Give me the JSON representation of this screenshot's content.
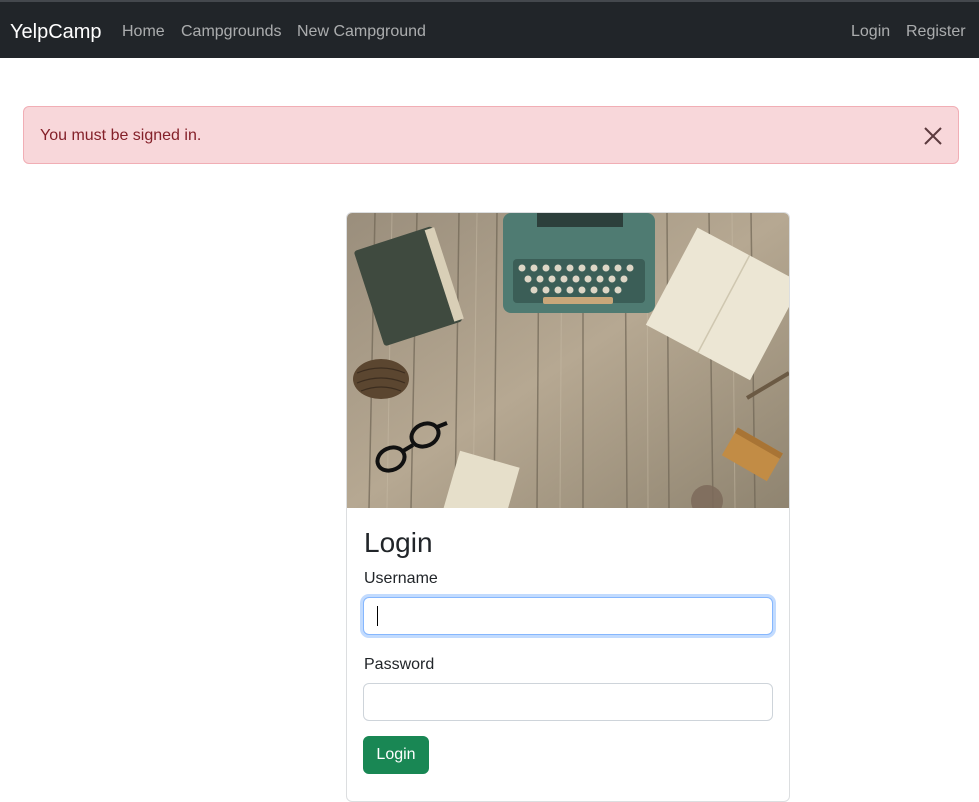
{
  "navbar": {
    "brand": "YelpCamp",
    "links": [
      "Home",
      "Campgrounds",
      "New Campground"
    ],
    "auth_links": [
      "Login",
      "Register"
    ]
  },
  "alert": {
    "message": "You must be signed in.",
    "close_icon": "close-icon"
  },
  "card": {
    "image_icon": "desk-typewriter-photo",
    "title": "Login",
    "username_label": "Username",
    "username_value": "",
    "password_label": "Password",
    "password_value": "",
    "submit_label": "Login"
  },
  "colors": {
    "navbar_bg": "#212529",
    "alert_bg": "#f8d7da",
    "alert_text": "#842029",
    "button_bg": "#198754"
  }
}
